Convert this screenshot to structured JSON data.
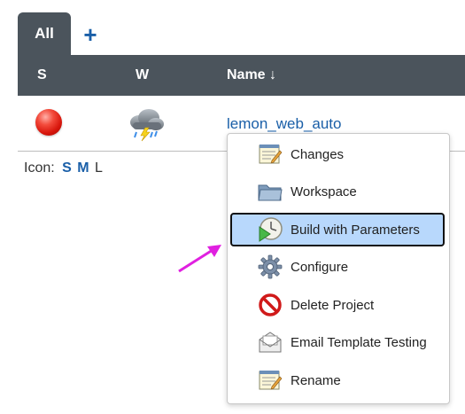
{
  "tabs": {
    "all_label": "All",
    "add_label": "+"
  },
  "table": {
    "columns": {
      "status": "S",
      "weather": "W",
      "name": "Name ↓"
    },
    "rows": [
      {
        "status_icon": "red-ball-icon",
        "weather_icon": "storm-cloud-icon",
        "name": "lemon_web_auto"
      }
    ]
  },
  "icon_size": {
    "label": "Icon:",
    "small": "S",
    "medium": "M",
    "large": "L",
    "current": "L"
  },
  "context_menu": {
    "items": [
      {
        "label": "Changes",
        "icon": "notepad-icon"
      },
      {
        "label": "Workspace",
        "icon": "folder-icon"
      },
      {
        "label": "Build with Parameters",
        "icon": "clock-run-icon",
        "highlighted": true
      },
      {
        "label": "Configure",
        "icon": "gear-icon"
      },
      {
        "label": "Delete Project",
        "icon": "no-entry-icon"
      },
      {
        "label": "Email Template Testing",
        "icon": "envelope-icon"
      },
      {
        "label": "Rename",
        "icon": "notepad-icon"
      }
    ]
  },
  "colors": {
    "header_bg": "#4b545c",
    "link": "#1a5fa8",
    "highlight": "#b8d8fc",
    "annotation_arrow": "#e020e0"
  }
}
